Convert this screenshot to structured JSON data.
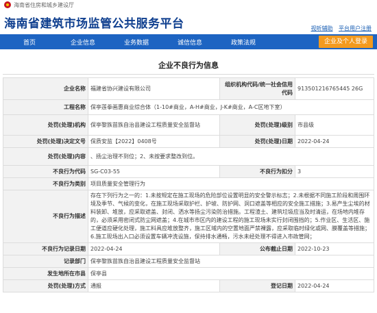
{
  "topbar": {
    "org": "海南省住房和城乡建设厅"
  },
  "header": {
    "title": "海南省建筑市场监管公共服务平台",
    "link_accessible": "视听辅助",
    "link_mobile": "平台用户注册"
  },
  "nav": {
    "items": [
      "首页",
      "企业信息",
      "业务数据",
      "诚信信息",
      "政策法规"
    ],
    "portal_button": "企业及个人登录"
  },
  "panel": {
    "title": "企业不良行为信息"
  },
  "record": {
    "company_label": "企业名称",
    "company": "福建省协兴建设有限公司",
    "code_label": "组织机构代码/统一社会信用代码",
    "code": "913501216765445 26G",
    "project_label": "工程名称",
    "project": "保亭莲拳画惠商业综合体（1-10#商业，A-H#商业，J-K#商业，A-C区地下室）",
    "handling_org_label": "处罚(处理)机构",
    "handling_org": "保亭黎族苗族自治县建设工程质量安全监督站",
    "level_label": "处罚(处理)级别",
    "level": "市县级",
    "doc_label": "处罚(处理)决定文号",
    "doc": "保质安监【2022】0408号",
    "date_label": "处罚(处理)日期",
    "date": "2022-04-24",
    "content_label": "处罚(处理)内容",
    "content": "、扬尘治理不到位；2、未按要求整改到位。",
    "behavior_code_label": "不良行为代码",
    "behavior_code": "SG-C03-55",
    "score_label": "不良行为扣分",
    "score": "3",
    "category_label": "不良行为类别",
    "category": "项目质量安全管理行为",
    "description_label": "不良行为描述",
    "description": "存在下列行为之一的：1.未按规定在施工现场的危险部位设置明显的安全警示标志；2.未根据不同施工阶段和周围环境及季节、气候的变化，在施工现场采取护栏、护坡、防护网、洞口遮盖等相应的安全施工措施；3.易产生尘埃的材料装卸、堆放，应采取遮盖、封闭、洒水等扬尘污染防治措施。工程渣土、建筑垃圾应当及时清运，在场地内堆存的，必须采用密闭式防尘网遮盖；4.在城市市区内的建设工程的施工现场未实行封闭围挡的；5.作业区、生活区、施工便道应硬化处理，施工料具应堆放整齐，施工区域内的空置地面严禁裸露，应采取临时绿化或网、膜覆盖等措施；6.施工现场出入口必须设置车辆冲洗设施，保持排水通畅，污水未经处理不得进入市政管网；",
    "record_date_label": "不良行为记录日期",
    "record_date": "2022-04-24",
    "valid_until_label": "公布截止日期",
    "valid_until": "2022-10-23",
    "record_org_label": "记录部门",
    "record_org": "保亭黎族苗族自治县建设工程质量安全监督站",
    "location_label": "发生地所在市县",
    "location": "保亭县",
    "status_label": "处罚(处理)方式",
    "status": "通报",
    "publish_date_label": "登记日期",
    "publish_date": "2022-04-24"
  }
}
